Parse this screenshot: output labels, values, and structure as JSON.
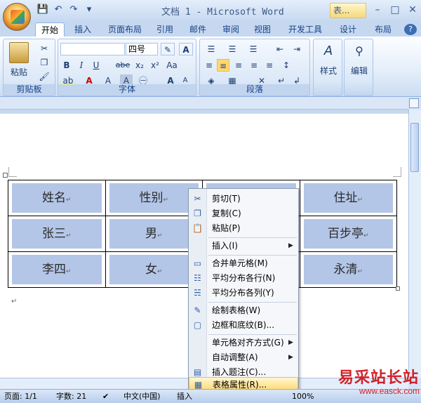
{
  "window": {
    "title": "文档 1 - Microsoft Word",
    "contextual_tab_group": "表...",
    "min_label": "–",
    "max_label": "□",
    "close_label": "✕"
  },
  "qat": {
    "save": "💾",
    "undo": "↶",
    "redo": "↷",
    "more": "▾"
  },
  "tabs": [
    "开始",
    "插入",
    "页面布局",
    "引用",
    "邮件",
    "审阅",
    "视图",
    "开发工具",
    "设计",
    "布局"
  ],
  "ribbon": {
    "clipboard": {
      "label": "剪贴板",
      "paste": "粘贴"
    },
    "font": {
      "label": "字体",
      "font_name": "",
      "font_size": "四号",
      "bold": "B",
      "italic": "I",
      "underline": "U",
      "strike": "abe",
      "subscript": "x₂",
      "superscript": "x²",
      "grow": "A",
      "shrink": "A"
    },
    "paragraph": {
      "label": "段落"
    },
    "styles": {
      "label": "样式"
    },
    "editing": {
      "label": "编辑"
    }
  },
  "table": {
    "rows": [
      [
        "姓名",
        "性别",
        "",
        "住址"
      ],
      [
        "张三",
        "男",
        "",
        "百步亭"
      ],
      [
        "李四",
        "女",
        "",
        "永清"
      ]
    ],
    "cell_mark": "↵"
  },
  "context_menu": {
    "items": [
      {
        "label": "剪切(T)",
        "icon": "scissors-icon"
      },
      {
        "label": "复制(C)",
        "icon": "copy-icon"
      },
      {
        "label": "粘贴(P)",
        "icon": "paste-icon"
      },
      {
        "label": "插入(I)",
        "submenu": true
      },
      {
        "label": "合并单元格(M)",
        "icon": "merge-cells-icon"
      },
      {
        "label": "平均分布各行(N)",
        "icon": "distribute-rows-icon"
      },
      {
        "label": "平均分布各列(Y)",
        "icon": "distribute-columns-icon"
      },
      {
        "label": "绘制表格(W)",
        "icon": "draw-table-icon"
      },
      {
        "label": "边框和底纹(B)...",
        "icon": "borders-icon"
      },
      {
        "label": "单元格对齐方式(G)",
        "submenu": true
      },
      {
        "label": "自动调整(A)",
        "submenu": true
      },
      {
        "label": "插入题注(C)...",
        "icon": "caption-icon"
      },
      {
        "label": "表格属性(R)...",
        "icon": "table-properties-icon",
        "highlighted": true
      }
    ]
  },
  "status": {
    "page": "页面: 1/1",
    "words": "字数: 21",
    "language": "中文(中国)",
    "mode": "插入",
    "zoom": "100%"
  },
  "watermark": {
    "line1": "易采站长站",
    "line2": "www.easck.com"
  }
}
